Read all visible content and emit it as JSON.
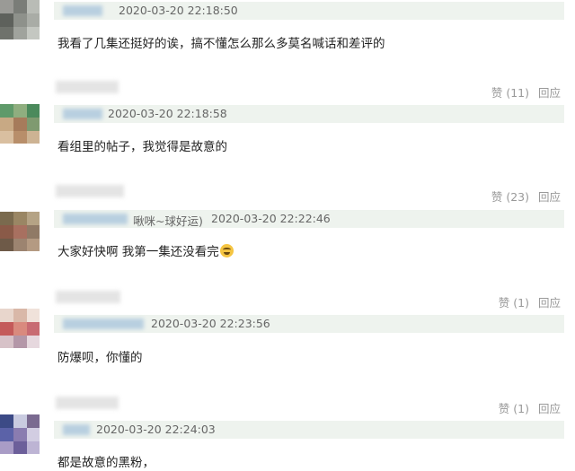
{
  "comments": [
    {
      "time": "2020-03-20 22:18:50",
      "extra": "",
      "text": "我看了几集还挺好的诶，搞不懂怎么那么多莫名喊话和差评的",
      "like_label": "",
      "reply_label": ""
    },
    {
      "time": "2020-03-20 22:18:58",
      "extra": "",
      "text": "看组里的帖子，我觉得是故意的",
      "like_label": "赞 (11)",
      "reply_label": "回应"
    },
    {
      "time": "2020-03-20 22:22:46",
      "extra": "啾咪~球好运)",
      "text": "大家好快啊 我第一集还没看完",
      "like_label": "赞 (23)",
      "reply_label": "回应"
    },
    {
      "time": "2020-03-20 22:23:56",
      "extra": "",
      "text": "防爆呗，你懂的",
      "like_label": "赞 (1)",
      "reply_label": "回应"
    },
    {
      "time": "2020-03-20 22:24:03",
      "extra": "",
      "text": "都是故意的黑粉，",
      "like_label": "赞 (1)",
      "reply_label": "回应"
    }
  ],
  "colors": {
    "meta_bg": "#eef3ee",
    "action_text": "#999999",
    "time_text": "#666666"
  }
}
